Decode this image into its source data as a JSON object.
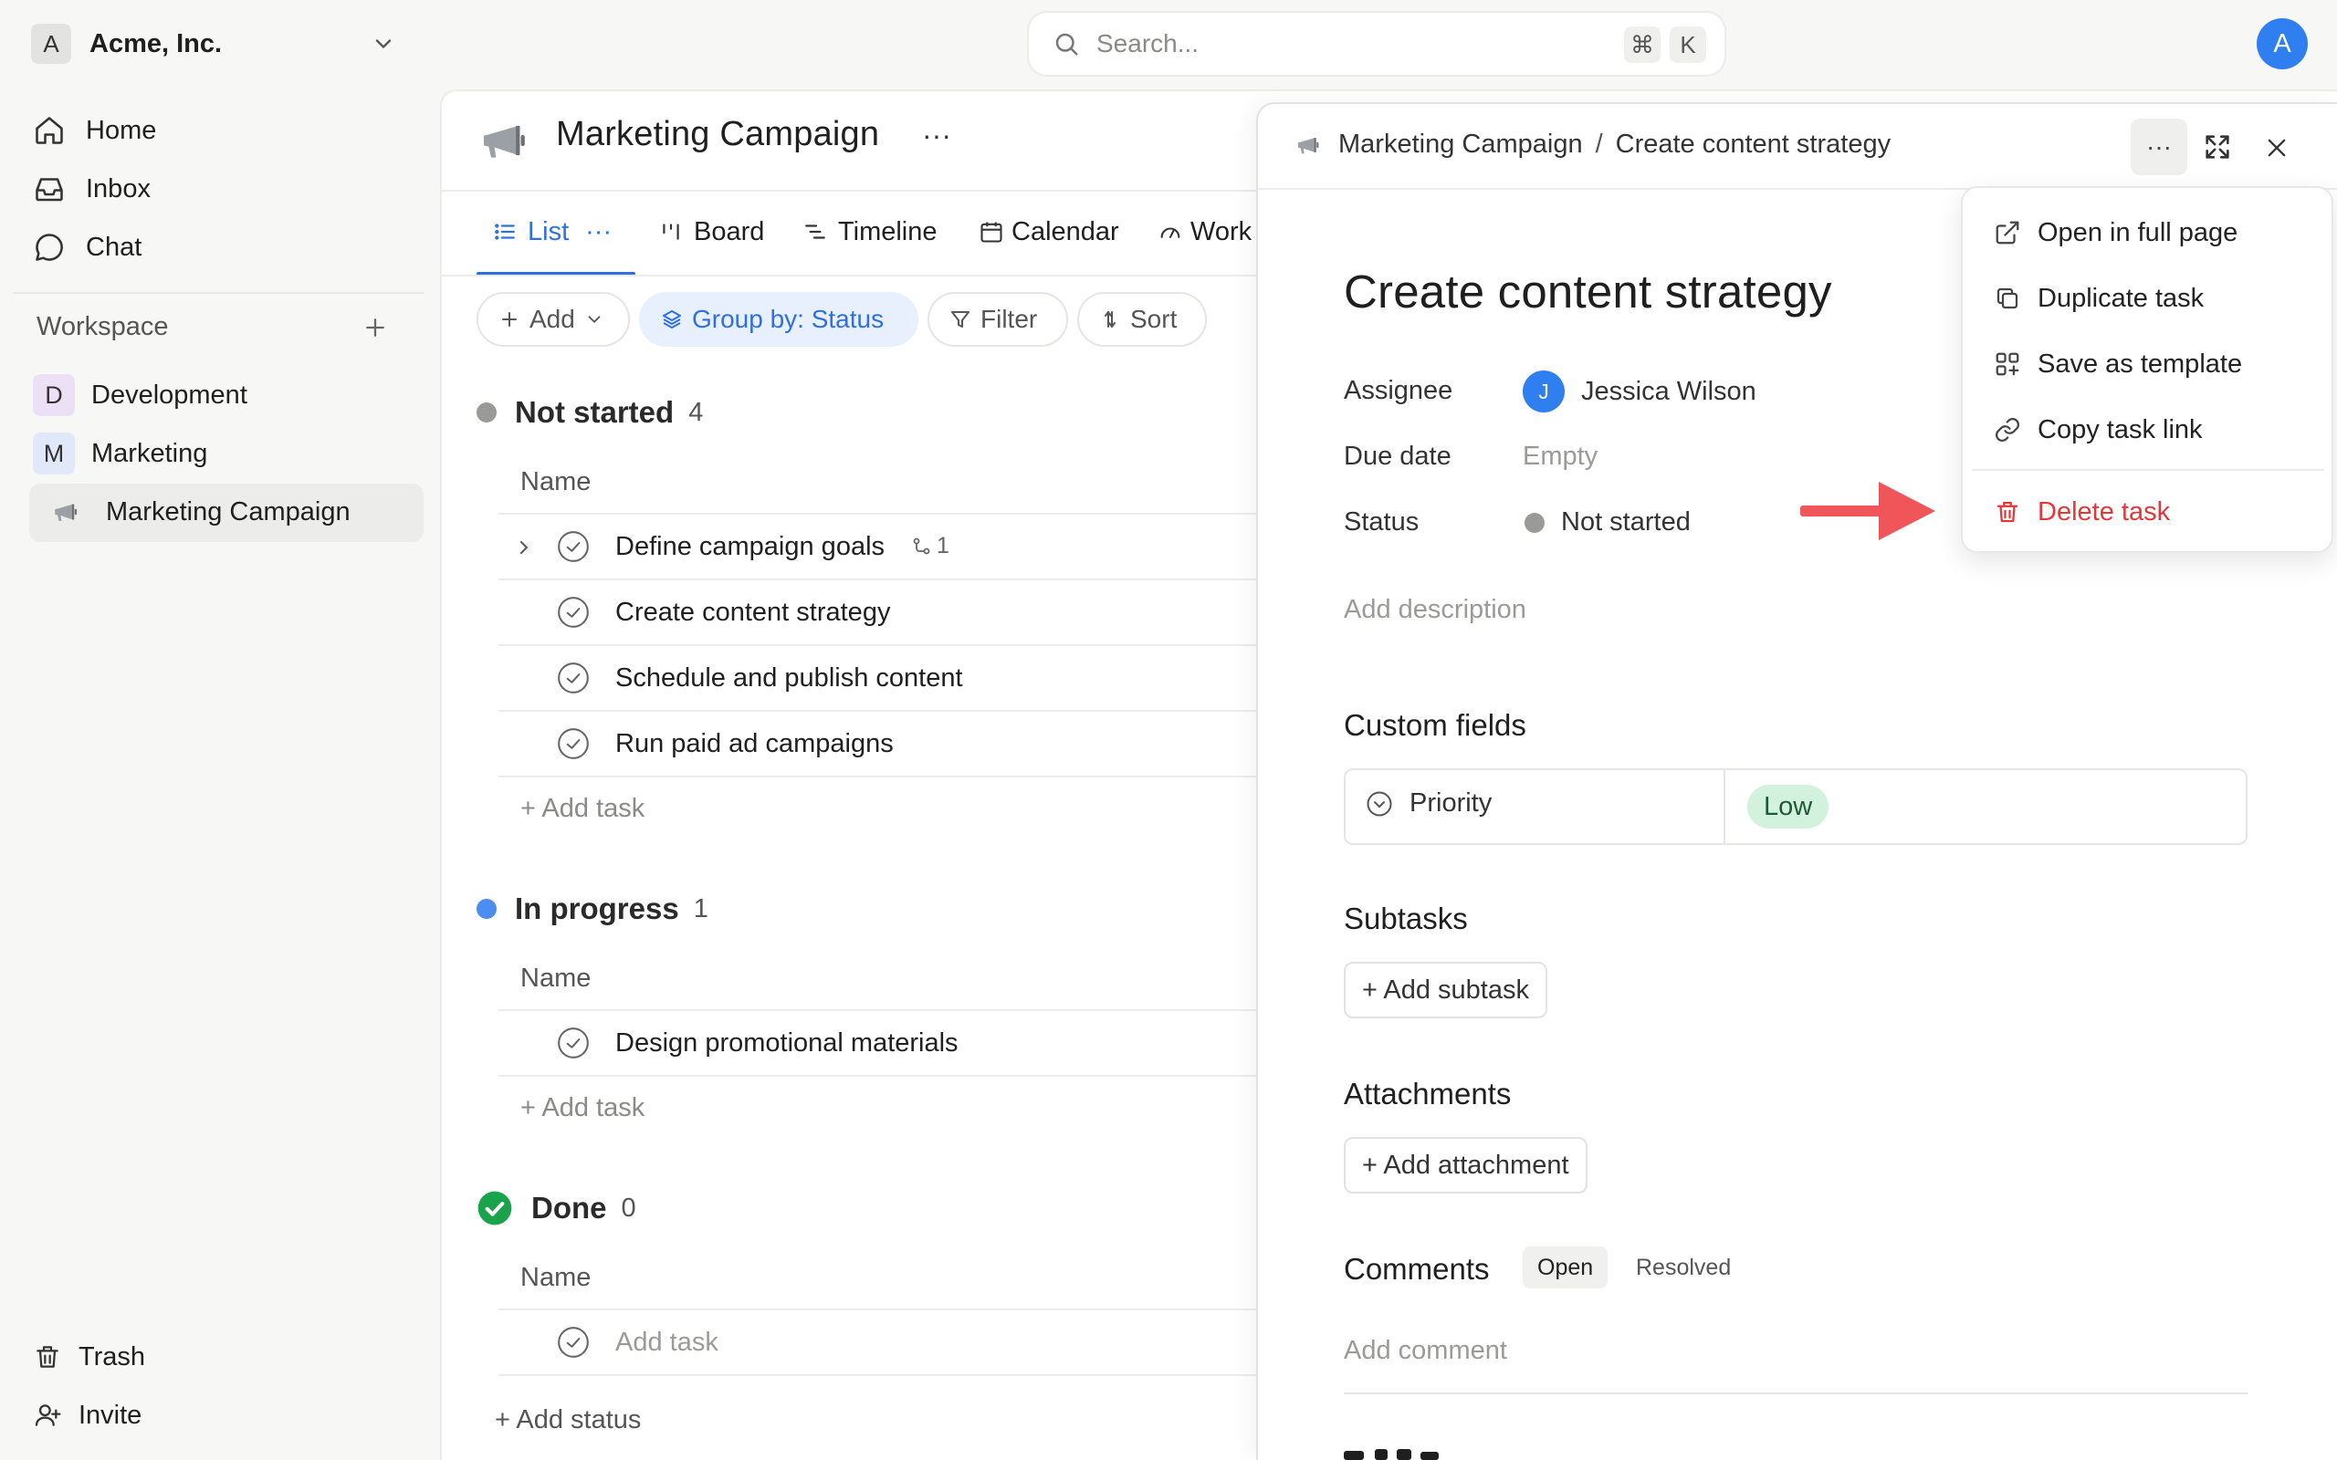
{
  "workspace": {
    "initial": "A",
    "name": "Acme, Inc."
  },
  "search": {
    "placeholder": "Search...",
    "shortcut_1": "⌘",
    "shortcut_2": "K"
  },
  "user": {
    "initial": "A"
  },
  "sidebar": {
    "nav": [
      {
        "label": "Home",
        "icon": "home-icon"
      },
      {
        "label": "Inbox",
        "icon": "inbox-icon"
      },
      {
        "label": "Chat",
        "icon": "chat-icon"
      }
    ],
    "workspace_heading": "Workspace",
    "projects": [
      {
        "badge": "D",
        "label": "Development",
        "color": "#ece0f7"
      },
      {
        "badge": "M",
        "label": "Marketing",
        "color": "#e0e8f9"
      },
      {
        "label": "Marketing Campaign",
        "icon": "megaphone-icon"
      }
    ],
    "footer": [
      {
        "label": "Trash",
        "icon": "trash-icon"
      },
      {
        "label": "Invite",
        "icon": "invite-user-icon"
      }
    ]
  },
  "project": {
    "title": "Marketing Campaign",
    "more": "···",
    "tabs": [
      {
        "label": "List",
        "active": true
      },
      {
        "label": "Board"
      },
      {
        "label": "Timeline"
      },
      {
        "label": "Calendar"
      },
      {
        "label": "Work"
      }
    ],
    "tab_more": "···",
    "toolbar": {
      "add": "Add",
      "group_by": "Group by: Status",
      "filter": "Filter",
      "sort": "Sort"
    }
  },
  "groups": [
    {
      "title": "Not started",
      "count": "4",
      "color": "#9a9a98",
      "column": "Name",
      "tasks": [
        {
          "name": "Define campaign goals",
          "subtasks": "1"
        },
        {
          "name": "Create content strategy"
        },
        {
          "name": "Schedule and publish content"
        },
        {
          "name": "Run paid ad campaigns"
        }
      ],
      "add_task": "+ Add task"
    },
    {
      "title": "In progress",
      "count": "1",
      "color": "#4c8df0",
      "column": "Name",
      "tasks": [
        {
          "name": "Design promotional materials"
        }
      ],
      "add_task": "+ Add task"
    },
    {
      "title": "Done",
      "count": "0",
      "color": "#1aa34a",
      "column": "Name",
      "tasks": [],
      "add_task_placeholder": "Add task"
    }
  ],
  "add_status": "+ Add status",
  "detail": {
    "breadcrumb": {
      "project": "Marketing Campaign",
      "separator": "/",
      "task": "Create content strategy"
    },
    "more": "···",
    "title": "Create content strategy",
    "props": {
      "assignee_label": "Assignee",
      "assignee_initial": "J",
      "assignee_name": "Jessica Wilson",
      "due_label": "Due date",
      "due_value": "Empty",
      "status_label": "Status",
      "status_value": "Not started"
    },
    "description_placeholder": "Add description",
    "custom_fields_heading": "Custom fields",
    "priority_label": "Priority",
    "priority_value": "Low",
    "subtasks_heading": "Subtasks",
    "add_subtask": "+ Add subtask",
    "attachments_heading": "Attachments",
    "add_attachment": "+ Add attachment",
    "comments_heading": "Comments",
    "comments_tabs": [
      {
        "label": "Open",
        "active": true
      },
      {
        "label": "Resolved"
      }
    ],
    "comment_placeholder": "Add comment"
  },
  "menu": {
    "items": [
      {
        "label": "Open in full page",
        "icon": "external-link-icon"
      },
      {
        "label": "Duplicate task",
        "icon": "duplicate-icon"
      },
      {
        "label": "Save as template",
        "icon": "template-icon"
      },
      {
        "label": "Copy task link",
        "icon": "link-icon"
      },
      {
        "label": "Delete task",
        "icon": "trash-icon",
        "danger": true
      }
    ]
  },
  "colors": {
    "accent": "#2f6fe0",
    "danger": "#e0383b",
    "arrow": "#f0555a"
  }
}
